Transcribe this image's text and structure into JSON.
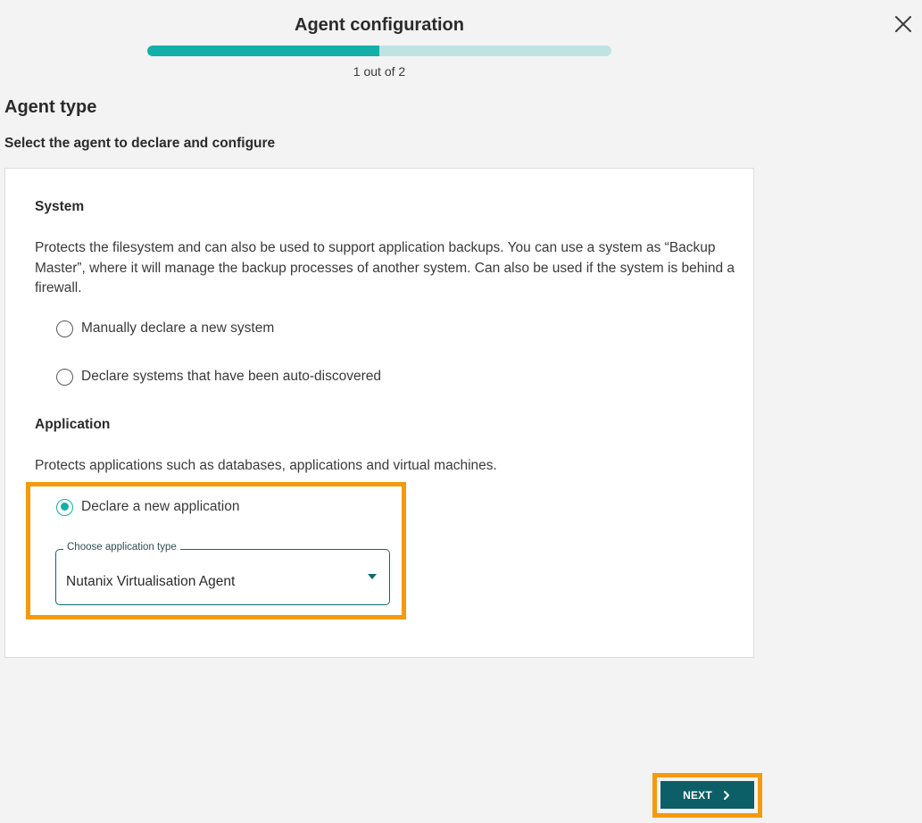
{
  "header": {
    "title": "Agent configuration",
    "progress_label": "1 out of 2",
    "progress_fraction": 0.5
  },
  "close_icon": "close-icon",
  "page": {
    "title": "Agent type",
    "subtitle": "Select the agent to declare and configure"
  },
  "system": {
    "title": "System",
    "description": "Protects the filesystem and can also be used to support application backups. You can use a system as “Backup Master”, where it will manage the backup processes of another system. Can also be used if the system is behind a firewall.",
    "options": [
      {
        "label": "Manually declare a new system",
        "selected": false
      },
      {
        "label": "Declare systems that have been auto-discovered",
        "selected": false
      }
    ]
  },
  "application": {
    "title": "Application",
    "description": "Protects applications such as databases, applications and virtual machines.",
    "option": {
      "label": "Declare a new application",
      "selected": true
    },
    "select": {
      "legend": "Choose application type",
      "value": "Nutanix Virtualisation Agent"
    }
  },
  "footer": {
    "next_label": "NEXT"
  },
  "colors": {
    "accent": "#12b0a8",
    "primary_button": "#0c5f66",
    "highlight": "#f59a0c"
  }
}
